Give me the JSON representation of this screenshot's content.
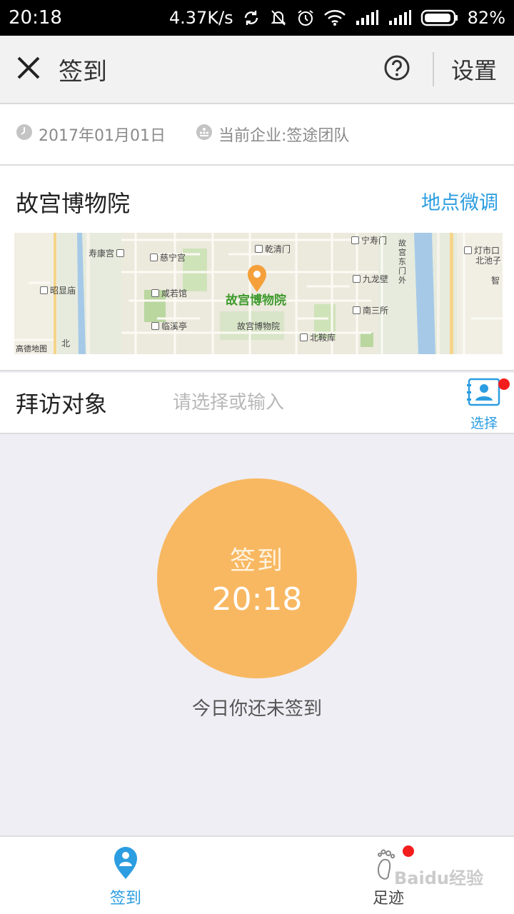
{
  "status_bar": {
    "time": "20:18",
    "network_speed": "4.37K/s",
    "battery": "82%",
    "icons": [
      "sync-icon",
      "mute-bell-icon",
      "alarm-icon",
      "wifi-icon",
      "signal-icon",
      "signal-icon",
      "battery-icon"
    ]
  },
  "nav": {
    "title": "签到",
    "settings_label": "设置",
    "icons": [
      "close-icon",
      "help-icon"
    ]
  },
  "info": {
    "date": "2017年01月01日",
    "company": "当前企业:签途团队",
    "icons": [
      "clock-icon",
      "company-icon"
    ]
  },
  "location": {
    "name": "故宫博物院",
    "adjust_label": "地点微调",
    "map": {
      "main_label": "故宫博物院",
      "brand": "高德地图",
      "labels": {
        "shoukang": "寿康宫",
        "cining": "慈宁宫",
        "qianqing": "乾清门",
        "ningshou": "宁寿门",
        "zhaoxian": "昭显庙",
        "xianruo": "咸若馆",
        "jiulong": "九龙壁",
        "nansan": "南三所",
        "linxi": "临溪亭",
        "museum_small": "故宫博物院",
        "beiqian": "北鞍库",
        "dongmen": "故宫东门外",
        "dengshikou": "灯市口",
        "beichizi": "北池子",
        "zhi": "智",
        "bei": "北"
      }
    }
  },
  "visit": {
    "label": "拜访对象",
    "placeholder": "请选择或输入",
    "value": "",
    "select_label": "选择"
  },
  "checkin": {
    "label": "签到",
    "time": "20:18",
    "status": "今日你还未签到"
  },
  "tabs": [
    {
      "label": "签到",
      "active": true,
      "icon": "person-pin-icon"
    },
    {
      "label": "足迹",
      "active": false,
      "icon": "footprint-icon"
    }
  ],
  "watermark": "Baidu经验",
  "colors": {
    "accent": "#2b9de0",
    "checkin_circle": "#f8b862",
    "badge": "#f41d1d"
  }
}
